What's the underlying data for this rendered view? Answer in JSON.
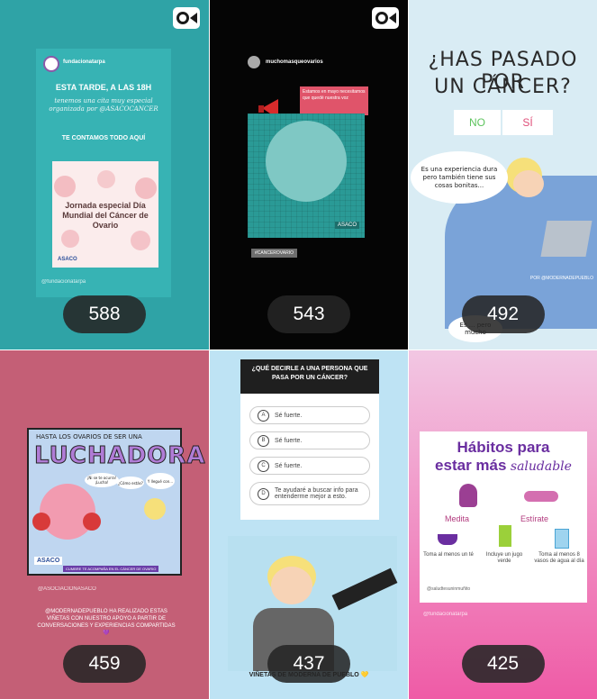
{
  "tiles": [
    {
      "count": "588",
      "username": "fundacionatarpa",
      "headline": "ESTA TARDE, A LAS 18H",
      "script_line": "tenemos una cita muy especial organizada por @ASACOCANCER",
      "cta": "TE CONTAMOS TODO AQUÍ",
      "poster_title": "Jornada especial Día Mundial del Cáncer de Ovario",
      "poster_org": "ASACO",
      "footer": "@fundacionatarpa"
    },
    {
      "count": "543",
      "username": "muchomasqueovarios",
      "note": "Estamos en mayo necesitamos que quedé nuestra voz",
      "hashtag": "#CANCEROVARIO",
      "tag": "ASACO"
    },
    {
      "count": "492",
      "title_line1": "¿HAS PASADO POR",
      "title_line2": "UN CÁNCER?",
      "option_no": "NO",
      "option_si": "SÍ",
      "bubble1": "Es una experiencia dura pero también tiene sus cosas bonitas...",
      "bubble2": "Es ... pero mucho",
      "credit": "POR @MODERNADEPUEBLO"
    },
    {
      "count": "459",
      "title_top": "HASTA LOS OVARIOS DE SER UNA",
      "title_main": "LUCHADORA",
      "speech1": "¡Ni se te ocurra! ¡Lucha!",
      "speech2": "¿Cómo estás?",
      "speech3": "Y llegué con...",
      "banner": "CUMBRE TE ACOMPAÑA EN EL CÁNCER DE OVARIO",
      "org": "ASACO",
      "tag_line": "@ASOCIACIONASACO",
      "body": "@MODERNADEPUEBLO HA REALIZADO ESTAS VIÑETAS CON NUESTRO APOYO A PARTIR DE CONVERSACIONES Y EXPERIENCIAS COMPARTIDAS 💜"
    },
    {
      "count": "437",
      "question": "¿QUÉ DECIRLE A UNA PERSONA QUE PASA POR UN CÁNCER?",
      "options": [
        {
          "letter": "A",
          "text": "Sé fuerte."
        },
        {
          "letter": "B",
          "text": "Sé fuerte."
        },
        {
          "letter": "C",
          "text": "Sé fuerte."
        },
        {
          "letter": "D",
          "text": "Te ayudaré a buscar info para entenderme mejor a esto."
        }
      ],
      "caption": "VIÑETAS DE MODERNA DE PUEBLO 💛"
    },
    {
      "count": "425",
      "title_line1": "Hábitos para",
      "title_line2_bold": "estar más",
      "title_line2_script": "saludable",
      "habits": [
        {
          "label": "Medita"
        },
        {
          "label": "Estírate"
        },
        {
          "label": "Toma al menos un té"
        },
        {
          "label": "Incluye un jugo verde"
        },
        {
          "label": "Toma al menos 8 vasos de agua al día"
        }
      ],
      "footer_handle": "@saludtesuninmuñito",
      "footer2": "@fundacionatarpa"
    }
  ]
}
